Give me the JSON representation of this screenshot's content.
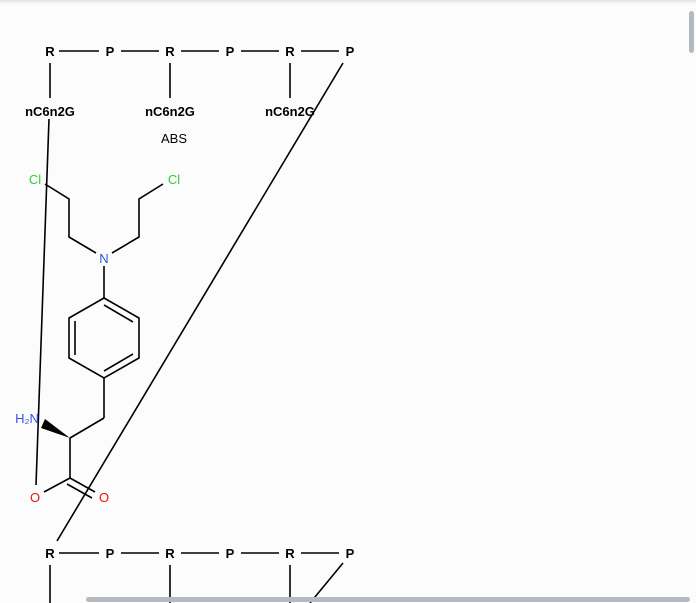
{
  "strand_top": {
    "residues": [
      "R",
      "P",
      "R",
      "P",
      "R",
      "P"
    ],
    "bases": [
      "nC6n2G",
      "nC6n2G",
      "nC6n2G"
    ]
  },
  "strand_bottom": {
    "residues": [
      "R",
      "P",
      "R",
      "P",
      "R",
      "P"
    ]
  },
  "stereo_note": "ABS",
  "atoms": {
    "cl_left": "Cl",
    "cl_right": "Cl",
    "nitrogen": "N",
    "amine": "H₂N",
    "oxygen_single": "O",
    "oxygen_double": "O"
  },
  "colors": {
    "chlorine": "#33cc33",
    "nitrogen": "#3355dd",
    "oxygen": "#ee1111",
    "bond": "#000000"
  }
}
